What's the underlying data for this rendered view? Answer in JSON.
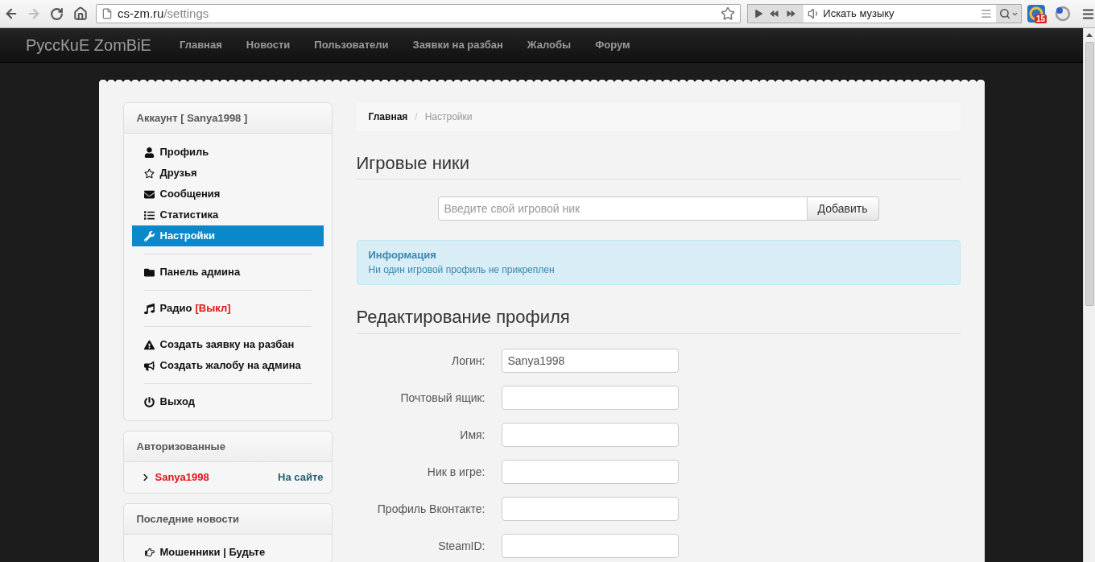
{
  "browser": {
    "back": {
      "disabled": false
    },
    "forward": {
      "disabled": true
    },
    "address": {
      "host": "cs-zm.ru",
      "path": "/settings"
    },
    "music_player": {
      "search_text": "Искать музыку"
    },
    "extension_badge": "15"
  },
  "navbar": {
    "brand": "РуссКuE ZomBiE",
    "links": [
      {
        "label": "Главная",
        "selected": false
      },
      {
        "label": "Новости",
        "selected": false
      },
      {
        "label": "Пользователи",
        "selected": false
      },
      {
        "label": "Заявки на разбан",
        "selected": false
      },
      {
        "label": "Жалобы",
        "selected": false
      },
      {
        "label": "Форум",
        "selected": false
      }
    ]
  },
  "sidebar": {
    "account": {
      "title": "Аккаунт [ Sanya1998 ]",
      "groups": [
        {
          "items": [
            {
              "label": "Профиль",
              "selected": false
            },
            {
              "label": "Друзья",
              "selected": false
            },
            {
              "label": "Сообщения",
              "selected": false
            },
            {
              "label": "Статистика",
              "selected": false
            },
            {
              "label": "Настройки",
              "selected": true
            }
          ]
        },
        {
          "items": [
            {
              "label": "Панель админа",
              "selected": false
            }
          ]
        },
        {
          "items": [
            {
              "label": "Радио",
              "status": "[Выкл]",
              "selected": false
            }
          ]
        },
        {
          "items": [
            {
              "label": "Создать заявку на разбан",
              "selected": false
            },
            {
              "label": "Создать жалобу на админа",
              "selected": false
            }
          ]
        },
        {
          "items": [
            {
              "label": "Выход",
              "selected": false
            }
          ]
        }
      ]
    },
    "online": {
      "title": "Авторизованные",
      "users": [
        {
          "name": "Sanya1998",
          "status": "На сайте"
        }
      ]
    },
    "news": {
      "title": "Последние новости",
      "items": [
        "Мошенники | Будьте"
      ]
    }
  },
  "main": {
    "breadcrumb": {
      "separator": "/",
      "items": [
        {
          "label": "Главная",
          "current": false
        },
        {
          "label": "Настройки",
          "current": true
        }
      ]
    },
    "nicks": {
      "title": "Игровые ники",
      "input": {
        "placeholder": "Введите свой игровой ник"
      },
      "button": "Добавить",
      "alert": {
        "title": "Информация",
        "text": "Ни один игровой профиль не прикреплен"
      }
    },
    "profile": {
      "title": "Редактирование профиля",
      "fields": [
        {
          "label": "Логин:",
          "value": "Sanya1998"
        },
        {
          "label": "Почтовый ящик:"
        },
        {
          "label": "Имя:"
        },
        {
          "label": "Ник в игре:"
        },
        {
          "label": "Профиль Вконтакте:"
        },
        {
          "label": "SteamID:"
        }
      ]
    }
  }
}
